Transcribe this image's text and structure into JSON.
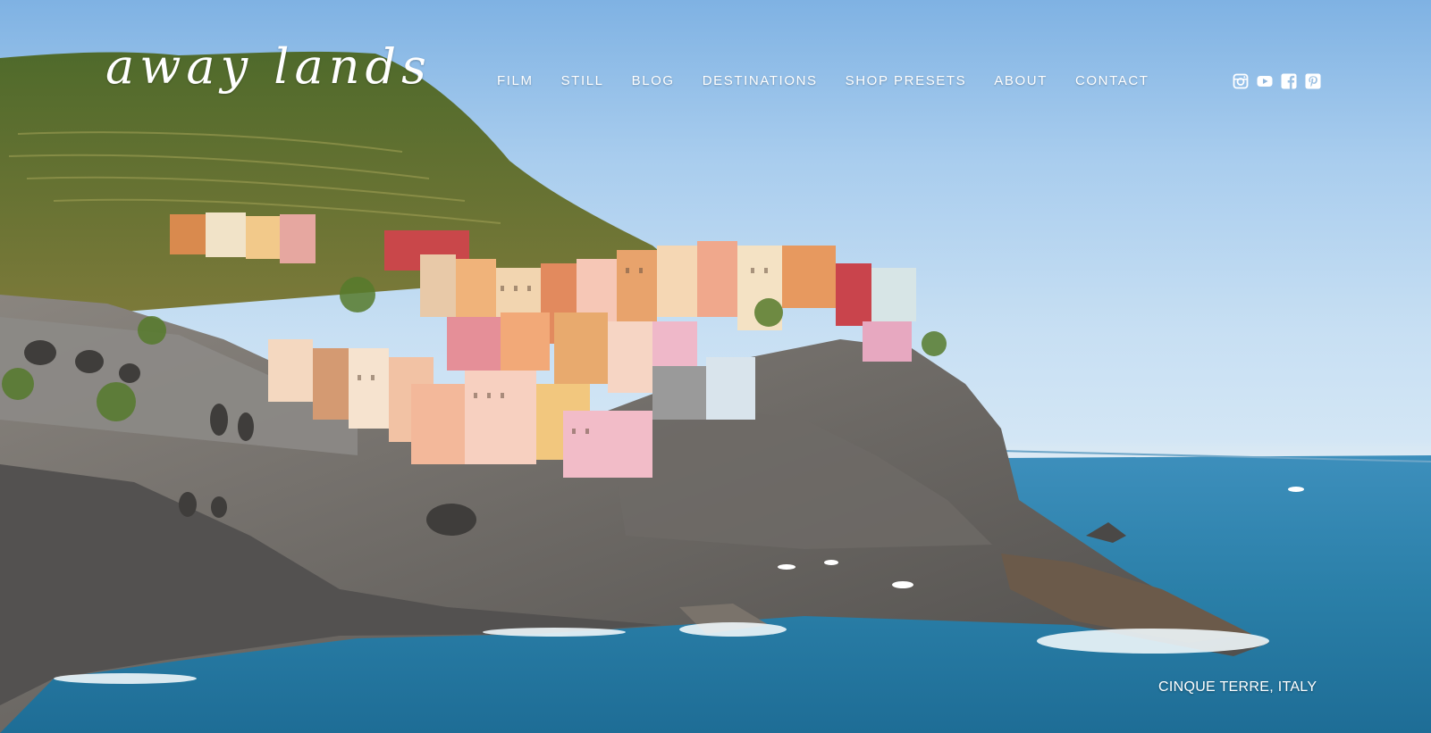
{
  "site": {
    "logo_text": "away lands"
  },
  "nav": {
    "items": [
      {
        "label": "FILM"
      },
      {
        "label": "STILL"
      },
      {
        "label": "BLOG"
      },
      {
        "label": "DESTINATIONS"
      },
      {
        "label": "SHOP PRESETS"
      },
      {
        "label": "ABOUT"
      },
      {
        "label": "CONTACT"
      }
    ]
  },
  "social": {
    "icons": [
      "instagram-icon",
      "youtube-icon",
      "facebook-icon",
      "pinterest-icon"
    ]
  },
  "hero": {
    "caption": "CINQUE TERRE, ITALY"
  },
  "colors": {
    "nav_text": "#ffffff",
    "sky": "#a9cdee",
    "sea": "#2a7fa8"
  }
}
